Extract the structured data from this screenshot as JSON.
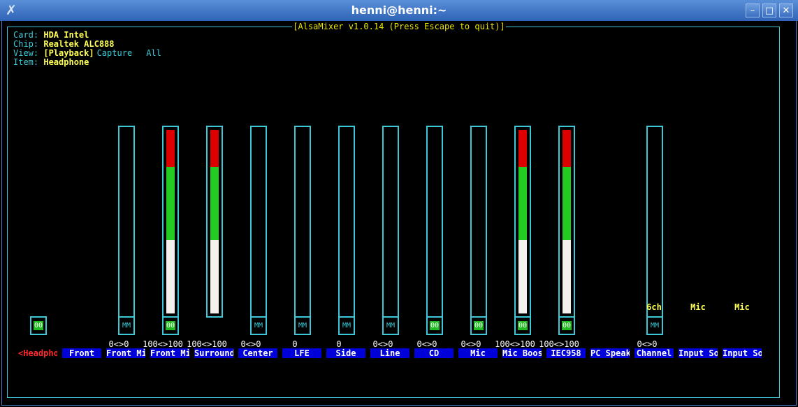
{
  "window": {
    "title": "henni@henni:~"
  },
  "mixer": {
    "header": "[AlsaMixer v1.0.14 (Press Escape to quit)]",
    "card_label": "Card:",
    "card_value": "HDA Intel",
    "chip_label": "Chip:",
    "chip_value": "Realtek ALC888",
    "view_label": "View:",
    "view_selected": "[Playback]",
    "view_option_capture": "Capture",
    "view_option_all": "All",
    "item_label": "Item:",
    "item_value": "Headphone"
  },
  "colors": {
    "frame": "#3cc8d6",
    "bar_red": "#dd0000",
    "bar_green": "#22cc22",
    "bar_white": "#f4f0ec",
    "name_bg": "#0000d8"
  },
  "channels": [
    {
      "name": "<Headphon>",
      "selected": true,
      "mute": "00",
      "volume": "",
      "level": null
    },
    {
      "name": "Front",
      "mute": "MM",
      "volume": "0<>0",
      "level": 0
    },
    {
      "name": "Front Mi",
      "mute": "00",
      "volume": "100<>100",
      "level": 100
    },
    {
      "name": "Front Mi",
      "mute": "",
      "volume": "100<>100",
      "level": 100
    },
    {
      "name": "Surround",
      "mute": "MM",
      "volume": "0<>0",
      "level": 0
    },
    {
      "name": "Center",
      "mute": "MM",
      "volume": "0",
      "level": 0
    },
    {
      "name": "LFE",
      "mute": "MM",
      "volume": "0",
      "level": 0
    },
    {
      "name": "Side",
      "mute": "MM",
      "volume": "0<>0",
      "level": 0
    },
    {
      "name": "Line",
      "mute": "00",
      "volume": "0<>0",
      "level": 0
    },
    {
      "name": "CD",
      "mute": "00",
      "volume": "0<>0",
      "level": 0
    },
    {
      "name": "Mic",
      "mute": "00",
      "volume": "100<>100",
      "level": 100
    },
    {
      "name": "Mic Boos",
      "mute": "",
      "volume": "100<>100",
      "level": 100
    },
    {
      "name": "IEC958",
      "mute": "00",
      "volume": "",
      "level": null
    },
    {
      "name": "PC Speak",
      "mute": "MM",
      "volume": "0<>0",
      "level": 0
    },
    {
      "name": "Channel",
      "enum_value": "6ch"
    },
    {
      "name": "Input So",
      "enum_value": "Mic"
    },
    {
      "name": "Input So",
      "enum_value": "Mic"
    }
  ]
}
